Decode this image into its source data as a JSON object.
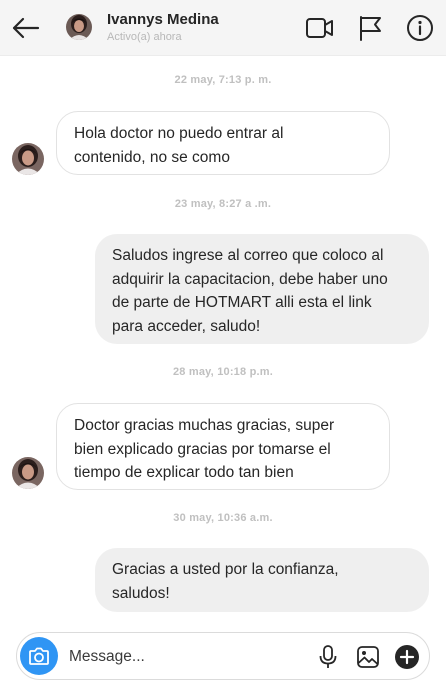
{
  "header": {
    "contact_name": "Ivannys Medina",
    "contact_status": "Activo(a) ahora",
    "icons": [
      "back-arrow-icon",
      "video-call-icon",
      "flag-icon",
      "info-icon"
    ]
  },
  "messages": [
    {
      "date": "22 may, 7:13 p. m.",
      "direction": "incoming",
      "lines": [
        "Hola doctor no puedo entrar al",
        "contenido, no se como"
      ]
    },
    {
      "date": "23 may, 8:27 a .m.",
      "direction": "outgoing",
      "lines": [
        "Saludos ingrese al correo que coloco al",
        "adquirir la capacitacion, debe haber uno",
        "de parte de HOTMART alli esta el link",
        "para acceder, saludo!"
      ]
    },
    {
      "date": "28 may, 10:18 p.m.",
      "direction": "incoming",
      "lines": [
        "Doctor gracias muchas gracias, super",
        "bien explicado gracias por tomarse el",
        "tiempo de explicar todo tan bien"
      ]
    },
    {
      "date": "30 may, 10:36 a.m.",
      "direction": "outgoing",
      "lines": [
        "Gracias a usted por la confianza,",
        "saludos!"
      ]
    }
  ],
  "composer": {
    "placeholder": "Message...",
    "icons": [
      "camera-icon",
      "microphone-icon",
      "image-icon",
      "plus-icon"
    ],
    "accent_color": "#2f95f4"
  }
}
